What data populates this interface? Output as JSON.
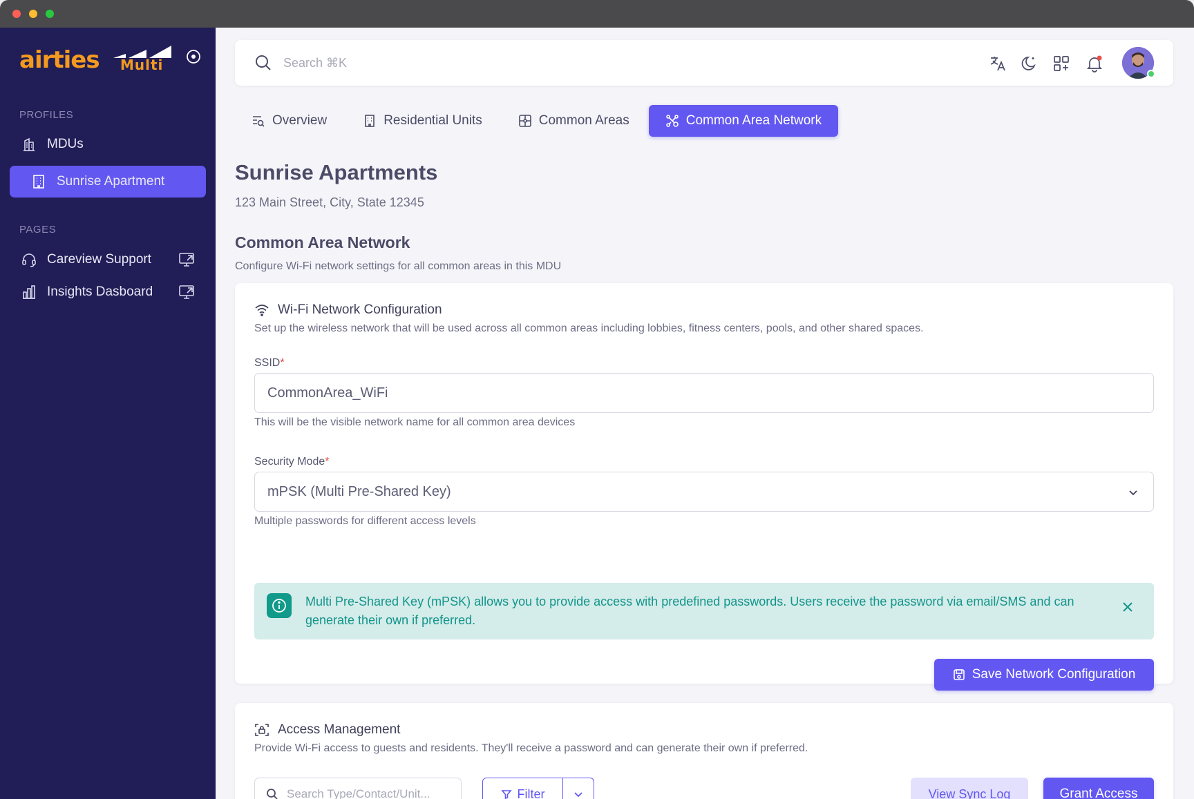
{
  "window": {
    "controls": [
      "close",
      "minimize",
      "maximize"
    ]
  },
  "brand": {
    "name": "airties",
    "sub": "Multi",
    "color": "#f39a1e"
  },
  "sidebar": {
    "sections": [
      {
        "label": "PROFILES",
        "items": [
          {
            "label": "MDUs",
            "icon": "building-icon"
          },
          {
            "label": "Sunrise Apartment",
            "icon": "apartment-icon",
            "active": true
          }
        ]
      },
      {
        "label": "PAGES",
        "items": [
          {
            "label": "Careview Support",
            "icon": "headset-icon",
            "external": true
          },
          {
            "label": "Insights Dasboard",
            "icon": "bar-chart-icon",
            "external": true
          }
        ]
      }
    ]
  },
  "topbar": {
    "search_placeholder": "Search ⌘K",
    "icons": [
      "translate-icon",
      "moon-icon",
      "apps-icon",
      "bell-icon"
    ],
    "has_notification": true
  },
  "tabs": [
    {
      "label": "Overview",
      "icon": "overview-icon",
      "active": false
    },
    {
      "label": "Residential Units",
      "icon": "building-icon",
      "active": false
    },
    {
      "label": "Common Areas",
      "icon": "common-area-icon",
      "active": false
    },
    {
      "label": "Common Area Network",
      "icon": "network-icon",
      "active": true
    }
  ],
  "page": {
    "title": "Sunrise Apartments",
    "address": "123 Main Street, City, State 12345",
    "section_title": "Common Area Network",
    "section_desc": "Configure Wi-Fi network settings for all common areas in this MDU"
  },
  "wifi_card": {
    "title": "Wi-Fi Network Configuration",
    "subtitle": "Set up the wireless network that will be used across all common areas including lobbies, fitness centers, pools, and other shared spaces.",
    "ssid": {
      "label": "SSID",
      "required": "*",
      "value": "CommonArea_WiFi",
      "helper": "This will be the visible network name for all common area devices"
    },
    "security": {
      "label": "Security Mode",
      "required": "*",
      "value": "mPSK (Multi Pre-Shared Key)",
      "helper": "Multiple passwords for different access levels"
    },
    "alert": {
      "text": "Multi Pre-Shared Key (mPSK) allows you to provide access with predefined passwords. Users receive the password via email/SMS and can generate their own if preferred."
    },
    "save_label": "Save Network Configuration"
  },
  "access_card": {
    "title": "Access Management",
    "subtitle": "Provide Wi-Fi access to guests and residents. They'll receive a password and can generate their own if preferred.",
    "search_placeholder": "Search Type/Contact/Unit...",
    "filter_label": "Filter",
    "sync_log_label": "View Sync Log",
    "grant_label": "Grant Access"
  },
  "colors": {
    "sidebar_bg": "#211d57",
    "accent": "#6257f0",
    "info_bg": "#d4ecea",
    "info_text": "#12958a"
  }
}
